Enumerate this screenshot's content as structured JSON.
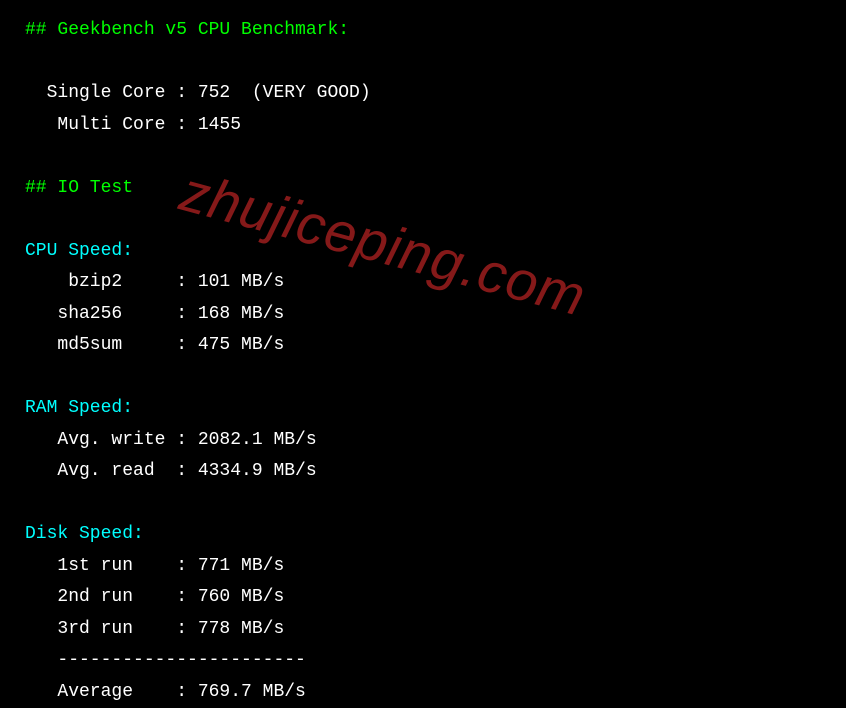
{
  "sections": {
    "geekbench": {
      "header": "## Geekbench v5 CPU Benchmark:",
      "single_core": {
        "label": "  Single Core : ",
        "value": "752  (VERY GOOD)"
      },
      "multi_core": {
        "label": "   Multi Core : ",
        "value": "1455"
      }
    },
    "io_test": {
      "header": "## IO Test"
    },
    "cpu_speed": {
      "header": "CPU Speed:",
      "bzip2": {
        "label": "    bzip2     : ",
        "value": "101 MB/s"
      },
      "sha256": {
        "label": "   sha256     : ",
        "value": "168 MB/s"
      },
      "md5sum": {
        "label": "   md5sum     : ",
        "value": "475 MB/s"
      }
    },
    "ram_speed": {
      "header": "RAM Speed:",
      "write": {
        "label": "   Avg. write : ",
        "value": "2082.1 MB/s"
      },
      "read": {
        "label": "   Avg. read  : ",
        "value": "4334.9 MB/s"
      }
    },
    "disk_speed": {
      "header": "Disk Speed:",
      "run1": {
        "label": "   1st run    : ",
        "value": "771 MB/s"
      },
      "run2": {
        "label": "   2nd run    : ",
        "value": "760 MB/s"
      },
      "run3": {
        "label": "   3rd run    : ",
        "value": "778 MB/s"
      },
      "separator": "   -----------------------",
      "average": {
        "label": "   Average    : ",
        "value": "769.7 MB/s"
      }
    }
  },
  "watermark": "zhujiceping.com"
}
